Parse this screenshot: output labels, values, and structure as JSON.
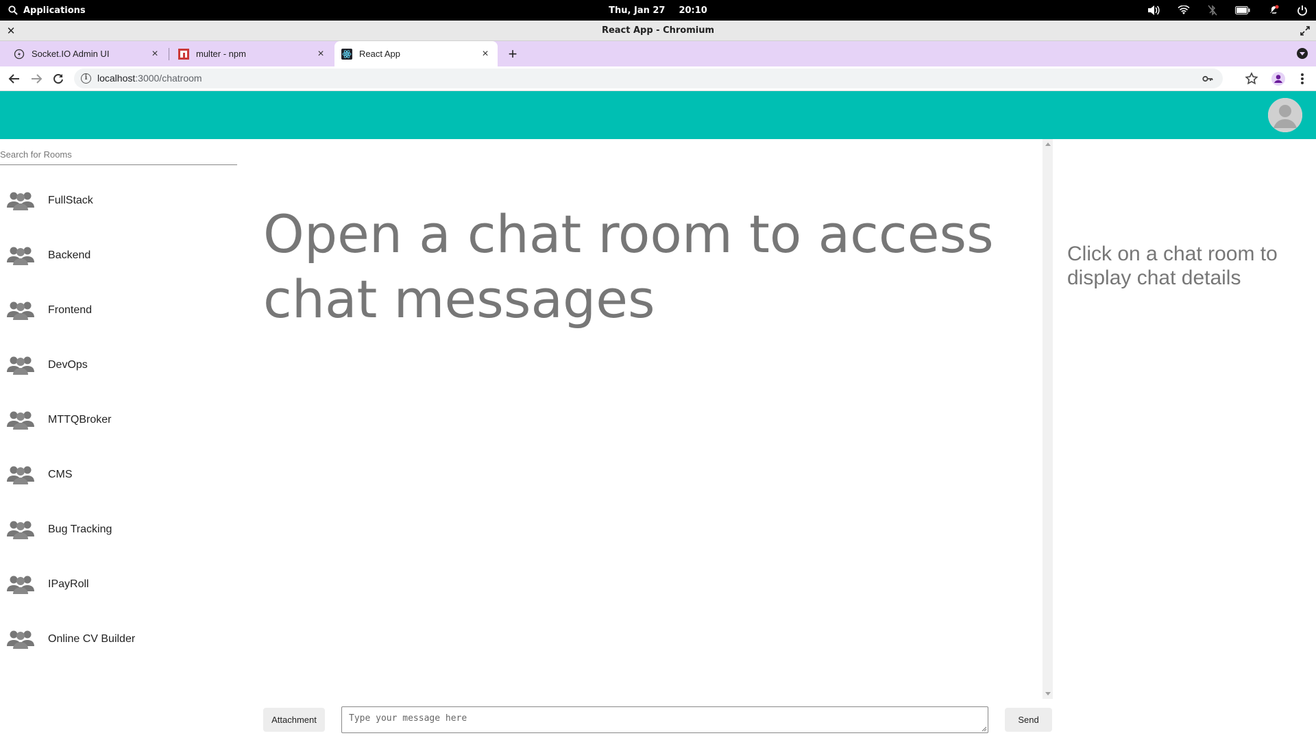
{
  "system": {
    "apps_label": "Applications",
    "date": "Thu, Jan 27",
    "time": "20:10"
  },
  "window": {
    "title": "React App - Chromium"
  },
  "tabs": [
    {
      "label": "Socket.IO Admin UI",
      "icon": "socketio-icon"
    },
    {
      "label": "multer - npm",
      "icon": "npm-icon"
    },
    {
      "label": "React App",
      "icon": "react-icon",
      "active": true
    }
  ],
  "omnibox": {
    "host": "localhost",
    "path": ":3000/chatroom"
  },
  "colors": {
    "header": "#00bfb3",
    "tabstrip": "#e6d3f7",
    "muted_text": "#777777"
  },
  "sidebar": {
    "search_placeholder": "Search for Rooms",
    "rooms": [
      {
        "label": "FullStack"
      },
      {
        "label": "Backend"
      },
      {
        "label": "Frontend"
      },
      {
        "label": "DevOps"
      },
      {
        "label": "MTTQBroker"
      },
      {
        "label": "CMS"
      },
      {
        "label": "Bug Tracking"
      },
      {
        "label": "IPayRoll"
      },
      {
        "label": "Online CV Builder"
      }
    ]
  },
  "main": {
    "empty_message": "Open a chat room to access chat messages"
  },
  "details": {
    "hint": "Click on a chat room to display chat details"
  },
  "composer": {
    "attachment_label": "Attachment",
    "message_placeholder": "Type your message here",
    "send_label": "Send"
  }
}
